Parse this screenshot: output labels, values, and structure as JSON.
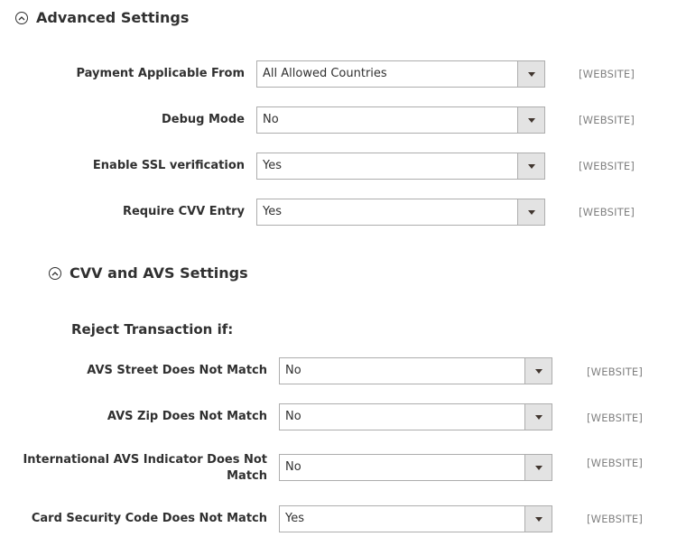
{
  "advanced": {
    "title": "Advanced Settings",
    "fields": [
      {
        "label": "Payment Applicable From",
        "value": "All Allowed Countries",
        "scope": "[WEBSITE]"
      },
      {
        "label": "Debug Mode",
        "value": "No",
        "scope": "[WEBSITE]"
      },
      {
        "label": "Enable SSL verification",
        "value": "Yes",
        "scope": "[WEBSITE]"
      },
      {
        "label": "Require CVV Entry",
        "value": "Yes",
        "scope": "[WEBSITE]"
      }
    ]
  },
  "cvv": {
    "title": "CVV and AVS Settings",
    "subheading": "Reject Transaction if:",
    "fields": [
      {
        "label": "AVS Street Does Not Match",
        "value": "No",
        "scope": "[WEBSITE]"
      },
      {
        "label": "AVS Zip Does Not Match",
        "value": "No",
        "scope": "[WEBSITE]"
      },
      {
        "label_line1": "International AVS Indicator Does Not",
        "label_line2": "Match",
        "value": "No",
        "scope": "[WEBSITE]"
      },
      {
        "label": "Card Security Code Does Not Match",
        "value": "Yes",
        "scope": "[WEBSITE]"
      }
    ]
  },
  "icons": {
    "collapse": "collapse-circle-icon",
    "dropdown": "dropdown-arrow-icon"
  }
}
